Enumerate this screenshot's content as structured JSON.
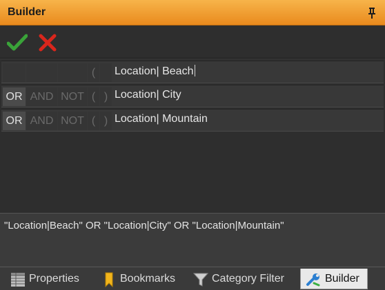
{
  "panel": {
    "title": "Builder"
  },
  "toolbar": {
    "accept_icon": "checkmark-icon",
    "reject_icon": "x-icon",
    "accept_color": "#3aa339",
    "reject_color": "#d9261c"
  },
  "rows": [
    {
      "operators": {
        "or": "",
        "and": "",
        "not": "",
        "lparen": "(",
        "rparen": ""
      },
      "expression": "Location| Beach"
    },
    {
      "operators": {
        "or": "OR",
        "and": "AND",
        "not": "NOT",
        "lparen": "(",
        "rparen": ")"
      },
      "active": "or",
      "expression": "Location| City"
    },
    {
      "operators": {
        "or": "OR",
        "and": "AND",
        "not": "NOT",
        "lparen": "(",
        "rparen": ")"
      },
      "active": "or",
      "expression": "Location| Mountain"
    }
  ],
  "query": "\"Location|Beach\" OR \"Location|City\" OR \"Location|Mountain\"",
  "tabs": [
    {
      "label": "Properties",
      "icon": "table-grid-icon"
    },
    {
      "label": "Bookmarks",
      "icon": "bookmark-icon"
    },
    {
      "label": "Category Filter",
      "icon": "funnel-icon"
    },
    {
      "label": "Builder",
      "icon": "wrench-icon",
      "selected": true
    }
  ],
  "colors": {
    "title_bar": "#f0a033",
    "panel_bg": "#2e2e2e",
    "selected_tab_bg": "#e9e9e9"
  }
}
